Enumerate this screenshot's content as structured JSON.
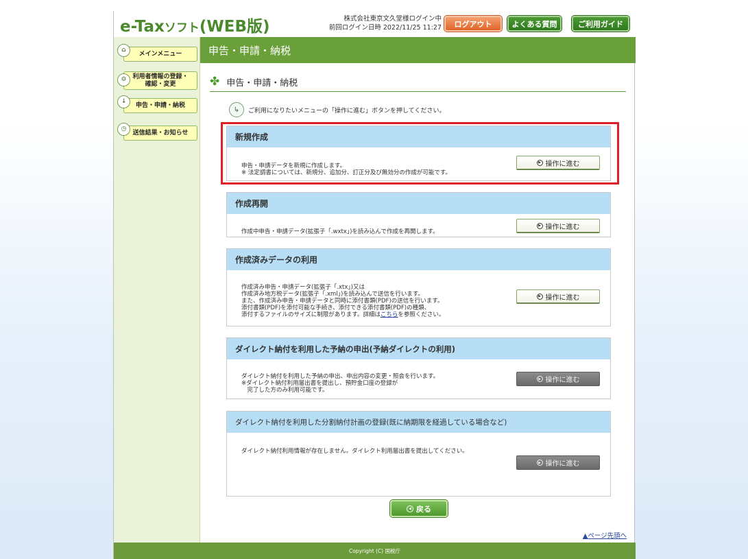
{
  "header": {
    "logo_main": "e-Tax",
    "logo_small": "ソフト",
    "logo_suffix": "(WEB版)",
    "user_line": "株式会社東京文久堂様ログイン中",
    "last_login": "前回ログイン日時  2022/11/25 11:27",
    "logout_label": "ログアウト",
    "faq_label": "よくある質問",
    "guide_label": "ご利用ガイド"
  },
  "sidebar": {
    "items": [
      {
        "label": "メインメニュー",
        "icon": "home-icon"
      },
      {
        "label": "利用者情報の登録・\n確認・変更",
        "icon": "settings-icon"
      },
      {
        "label": "申告・申請・納税",
        "icon": "document-icon"
      },
      {
        "label": "送信結果・お知らせ",
        "icon": "clock-icon"
      }
    ]
  },
  "main": {
    "title": "申告・申請・納税",
    "subtitle": "申告・申請・納税",
    "instruction": "ご利用になりたいメニューの「操作に進む」ボタンを押してください。",
    "go_label": "操作に進む",
    "panels": [
      {
        "title": "新規作成",
        "body": "申告・申請データを新規に作成します。\n※ 法定調書については、新規分、追加分、訂正分及び無効分の作成が可能です。",
        "enabled": true
      },
      {
        "title": "作成再開",
        "body": "作成中申告・申請データ(拡張子「.wxtx」)を読み込んで作成を再開します。",
        "enabled": true
      },
      {
        "title": "作成済みデータの利用",
        "body": "作成済み申告・申請データ(拡張子「.xtx」)又は\n作成済み地方税データ(拡張子「.xml」)を読み込んで送信を行います。\nまた、作成済み申告・申請データと同時に添付書類(PDF)の送信を行います。\n添付書類(PDF)を添付可能な手続き、添付できる添付書類(PDF)の種類、\n添付するファイルのサイズに制限があります。詳細は",
        "link": "こちら",
        "body_tail": "を参照ください。",
        "enabled": true
      },
      {
        "title": "ダイレクト納付を利用した予納の申出(予納ダイレクトの利用)",
        "body": "ダイレクト納付を利用した予納の申出、申出内容の変更・照会を行います。\n※ダイレクト納付利用届出書を提出し、預貯金口座の登録が\n　完了した方のみ利用可能です。",
        "enabled": false
      },
      {
        "title": "ダイレクト納付を利用した分割納付計画の登録(既に納期限を経過している場合など)",
        "body": "ダイレクト納付利用情報が存在しません。ダイレクト利用届出書を提出してください。",
        "enabled": false
      }
    ],
    "back_label": "戻る",
    "page_top_label": "ページ先頭へ"
  },
  "footer": {
    "copyright": "Copyright (C) 国税庁"
  },
  "colors": {
    "brand_green": "#6aa03a",
    "panel_header": "#b7def4",
    "highlight": "#e01e26",
    "logout": "#e0642a"
  }
}
